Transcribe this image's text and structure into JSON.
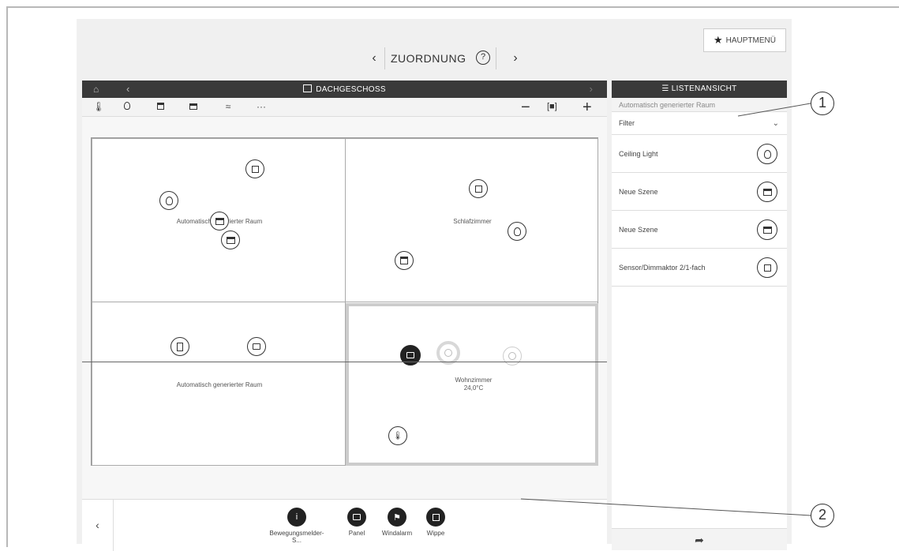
{
  "header": {
    "title": "ZUORDNUNG",
    "prev_label": "‹",
    "next_label": "›",
    "help_label": "?",
    "mainmenu_label": "HAUPTMENÜ"
  },
  "floor": {
    "title": "DACHGESCHOSS",
    "home_label": "⌂",
    "back_label": "‹",
    "fwd_label": "›"
  },
  "toolbar": {
    "more_label": "···",
    "zoom_out_label": "−",
    "zoom_fit_label": "[■]",
    "zoom_in_label": "+"
  },
  "rooms": [
    {
      "label": "Automatisch generierter Raum"
    },
    {
      "label": "Schlafzimmer"
    },
    {
      "label": "Automatisch generierter Raum"
    },
    {
      "label": "Wohnzimmer",
      "temp": "24,0°C"
    }
  ],
  "bottom": {
    "back_label": "‹",
    "devices": [
      {
        "label": "Bewegungsmelder-S...",
        "icon": "motion-sensor-icon"
      },
      {
        "label": "Panel",
        "icon": "panel-icon"
      },
      {
        "label": "Windalarm",
        "icon": "wind-alarm-icon"
      },
      {
        "label": "Wippe",
        "icon": "rocker-icon"
      }
    ]
  },
  "list": {
    "title": "LISTENANSICHT",
    "subtitle": "Automatisch generierter Raum",
    "filter_label": "Filter",
    "filter_chevron": "⌄",
    "items": [
      {
        "label": "Ceiling Light",
        "icon": "bulb-icon"
      },
      {
        "label": "Neue Szene",
        "icon": "scene-icon"
      },
      {
        "label": "Neue Szene",
        "icon": "scene-icon"
      },
      {
        "label": "Sensor/Dimmaktor 2/1-fach",
        "icon": "sensor-dimmer-icon"
      }
    ],
    "footer_label": "➦"
  },
  "callouts": [
    "1",
    "2"
  ]
}
